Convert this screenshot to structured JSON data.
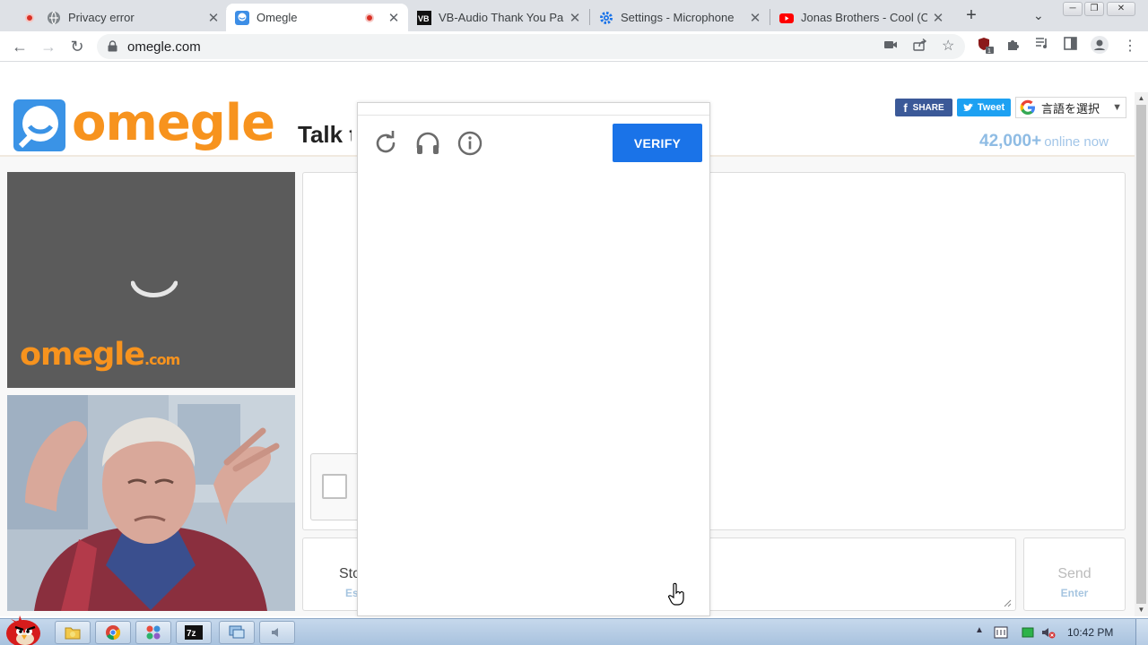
{
  "browser": {
    "tabs": [
      {
        "title": "Privacy error",
        "favicon": "privacy-error-icon",
        "recording": true,
        "active": false
      },
      {
        "title": "Omegle",
        "favicon": "omegle-favicon",
        "recording": true,
        "active": true
      },
      {
        "title": "VB-Audio Thank You Pa",
        "favicon": "vb-audio-favicon",
        "recording": false,
        "active": false
      },
      {
        "title": "Settings - Microphone",
        "favicon": "gear-icon",
        "recording": false,
        "active": false
      },
      {
        "title": "Jonas Brothers - Cool (C",
        "favicon": "youtube-icon",
        "recording": false,
        "active": false
      }
    ],
    "url": "omegle.com",
    "extension_badge": "1"
  },
  "page": {
    "logo_text": "omegle",
    "tagline": "Talk t",
    "share_label": "SHARE",
    "tweet_label": "Tweet",
    "translate_label": "言語を選択",
    "online_count": "42,000+",
    "online_label": "online now",
    "video_logo_main": "omegle",
    "video_logo_suffix": ".com",
    "stop_label": "Sto",
    "stop_key": "Es",
    "send_label": "Send",
    "send_key": "Enter"
  },
  "captcha": {
    "verify_label": "VERIFY",
    "icons": [
      "refresh-icon",
      "headphones-icon",
      "info-icon"
    ]
  },
  "taskbar": {
    "clock": "10:42 PM",
    "pinned": [
      "explorer-icon",
      "chrome-icon",
      "apps-icon",
      "7zip-icon",
      "network-icon",
      "audio-icon"
    ]
  },
  "colors": {
    "omegle_orange": "#f7931e",
    "verify_blue": "#1a73e8",
    "facebook_blue": "#3b5998",
    "twitter_blue": "#1da1f2",
    "online_blue": "#8fbce4"
  }
}
